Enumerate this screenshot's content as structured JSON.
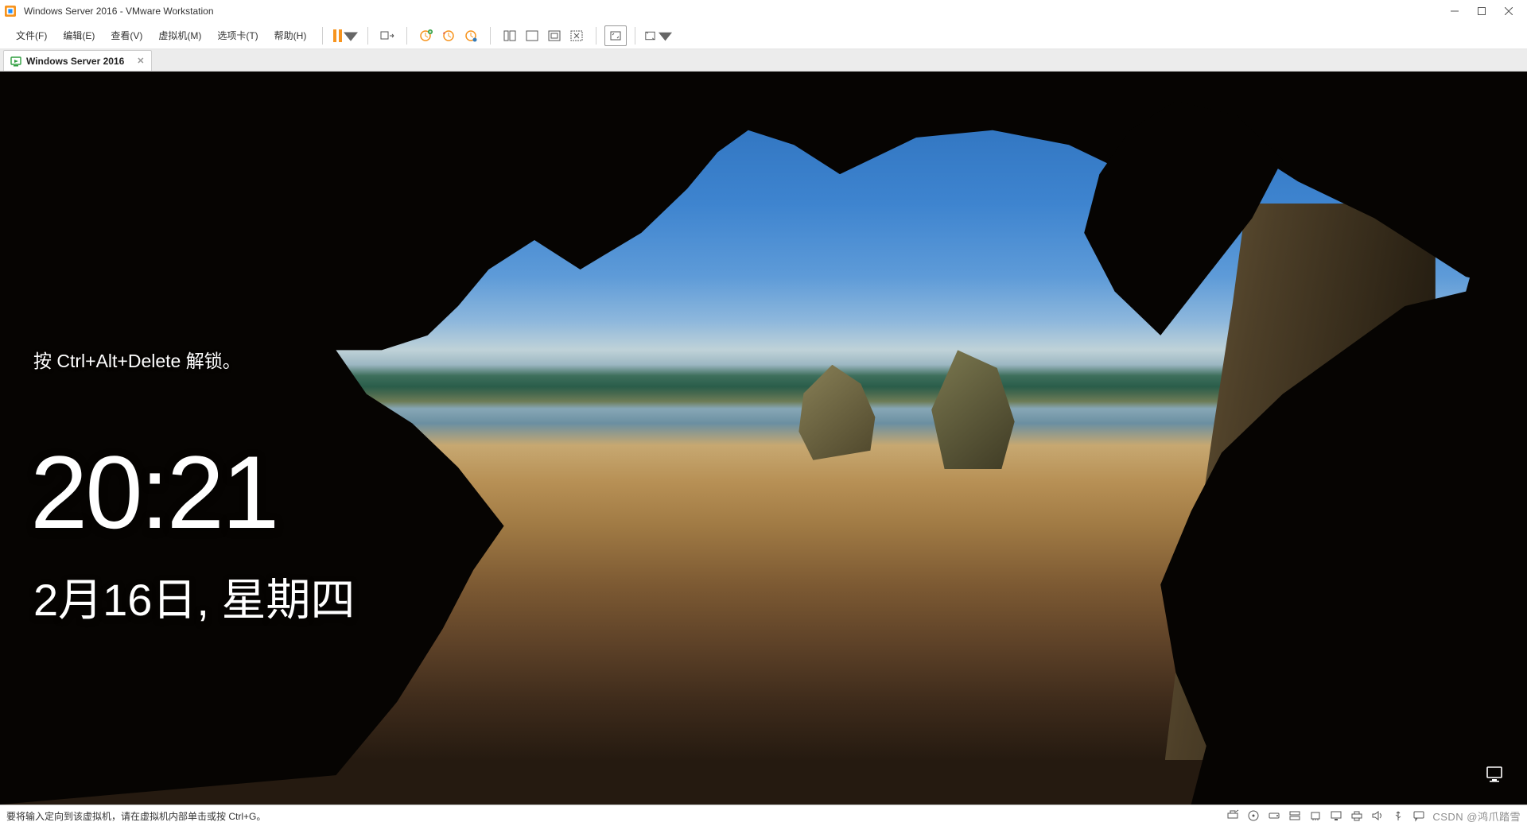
{
  "window": {
    "title": "Windows Server 2016 - VMware Workstation",
    "controls": {
      "min": "min",
      "max": "max",
      "close": "close"
    }
  },
  "menu": {
    "items": [
      "文件(F)",
      "编辑(E)",
      "查看(V)",
      "虚拟机(M)",
      "选项卡(T)",
      "帮助(H)"
    ]
  },
  "toolbar": {
    "pause": "pause",
    "snapshot": "snapshot",
    "clock1": "snapshot-take",
    "clock2": "snapshot-revert",
    "clock3": "snapshot-manager",
    "view1": "single-window",
    "view2": "multi-window",
    "view3": "unity",
    "view4": "console-view",
    "fullscreen": "fullscreen",
    "stretch": "stretch"
  },
  "tabs": [
    {
      "label": "Windows Server 2016"
    }
  ],
  "lockscreen": {
    "prompt": "按 Ctrl+Alt+Delete 解锁。",
    "time": "20:21",
    "date": "2月16日, 星期四",
    "network_icon": "monitor"
  },
  "statusbar": {
    "message": "要将输入定向到该虚拟机，请在虚拟机内部单击或按 Ctrl+G。",
    "watermark": "CSDN @鸿爪踏雪",
    "icons": [
      "printer-out",
      "cd",
      "hdd",
      "hdd2",
      "nic",
      "audio",
      "printer",
      "usb",
      "message"
    ]
  }
}
